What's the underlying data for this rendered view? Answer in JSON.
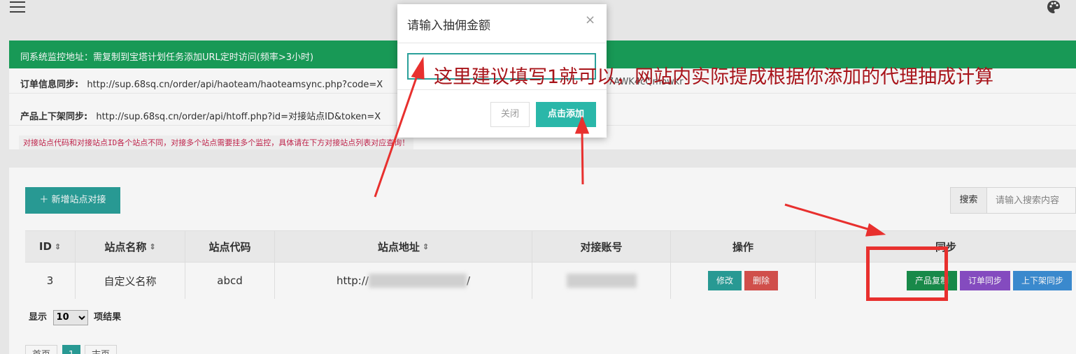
{
  "header": {
    "menu_icon": "hamburger-menu-icon",
    "theme_icon": "palette-icon"
  },
  "monitor": {
    "bar_text": "同系统监控地址：需复制到宝塔计划任务添加URL定时访问(频率>3小时)",
    "order_sync_label": "订单信息同步:",
    "order_sync_url": "http://sup.68sq.cn/order/api/haoteam/haoteamsync.php?code=X",
    "order_sync_tail": "7AWK4cQmowkr",
    "product_label": "产品上下架同步:",
    "product_url": "http://sup.68sq.cn/order/api/htoff.php?id=对接站点ID&token=X",
    "warning": "对接站点代码和对接站点ID各个站点不同，对接多个站点需要挂多个监控，具体请在下方对接站点列表对应查询！"
  },
  "toolbar": {
    "add_label": "＋ 新增站点对接",
    "search_label": "搜索",
    "search_placeholder": "请输入搜索内容"
  },
  "table": {
    "headers": {
      "id": "ID",
      "name": "站点名称",
      "code": "站点代码",
      "url": "站点地址",
      "account": "对接账号",
      "ops": "操作",
      "sync": "同步"
    },
    "rows": [
      {
        "id": "3",
        "name": "自定义名称",
        "code": "abcd",
        "url_prefix": "http://",
        "url_suffix": "/",
        "ops": {
          "edit": "修改",
          "delete": "删除"
        },
        "sync": {
          "copy": "产品复制",
          "order": "订单同步",
          "shelf": "上下架同步"
        }
      }
    ]
  },
  "pagination": {
    "show_label": "显示",
    "page_size": "10",
    "result_label": "项结果",
    "first": "首页",
    "current": "1",
    "last": "末页"
  },
  "modal": {
    "title": "请输入抽佣金额",
    "close_icon": "×",
    "input_value": "",
    "cancel": "关闭",
    "confirm": "点击添加"
  },
  "annotation": {
    "text": "这里建议填写1就可以，网站内实际提成根据你添加的代理抽成计算",
    "color": "#a8141a",
    "box_color": "#e8302e"
  }
}
